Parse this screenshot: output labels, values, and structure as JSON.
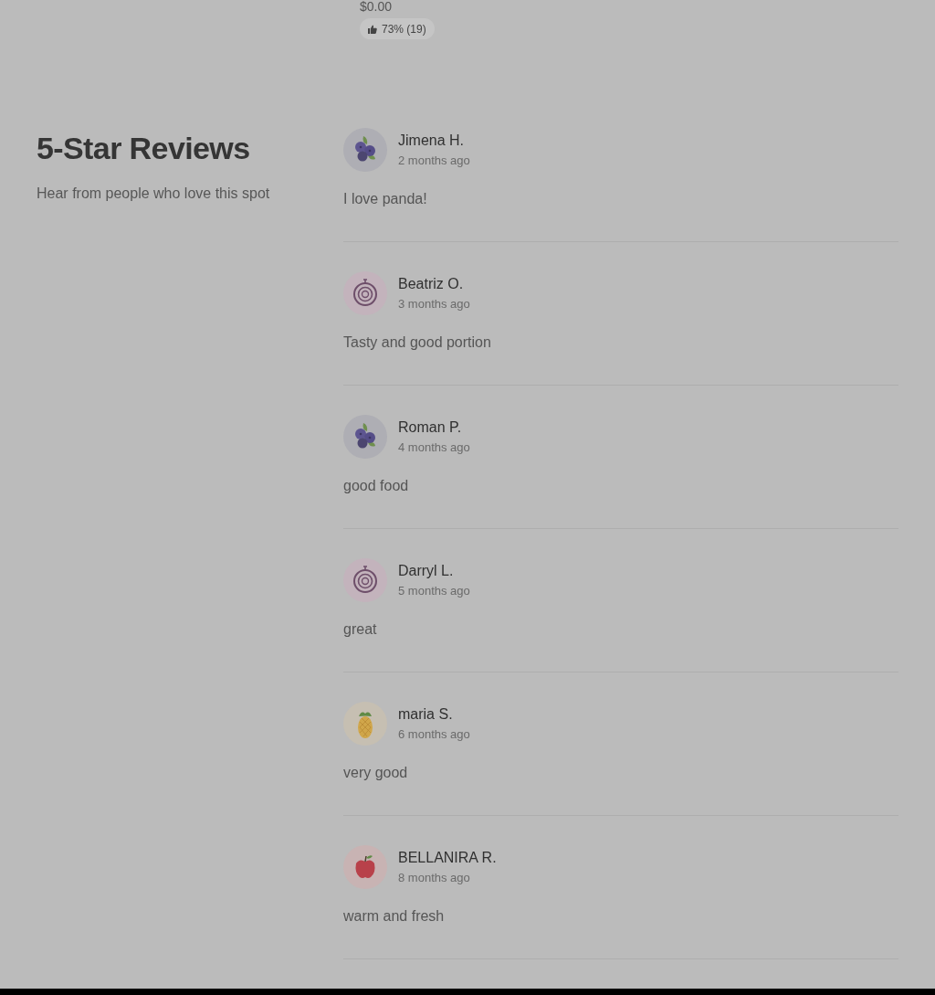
{
  "header": {
    "price": "$0.00",
    "rating_badge": "73% (19)"
  },
  "reviews_section": {
    "title": "5-Star Reviews",
    "subtitle": "Hear from people who love this spot",
    "reviews": [
      {
        "name": "Jimena H.",
        "time": "2 months ago",
        "text": "I love panda!",
        "avatar": {
          "kind": "blueberry"
        }
      },
      {
        "name": "Beatriz O.",
        "time": "3 months ago",
        "text": "Tasty and good portion",
        "avatar": {
          "kind": "onion"
        }
      },
      {
        "name": "Roman P.",
        "time": "4 months ago",
        "text": "good food",
        "avatar": {
          "kind": "blueberry"
        }
      },
      {
        "name": "Darryl L.",
        "time": "5 months ago",
        "text": "great",
        "avatar": {
          "kind": "onion"
        }
      },
      {
        "name": "maria S.",
        "time": "6 months ago",
        "text": "very good",
        "avatar": {
          "kind": "pineapple"
        }
      },
      {
        "name": "BELLANIRA R.",
        "time": "8 months ago",
        "text": "warm and fresh",
        "avatar": {
          "kind": "apple"
        }
      }
    ]
  }
}
